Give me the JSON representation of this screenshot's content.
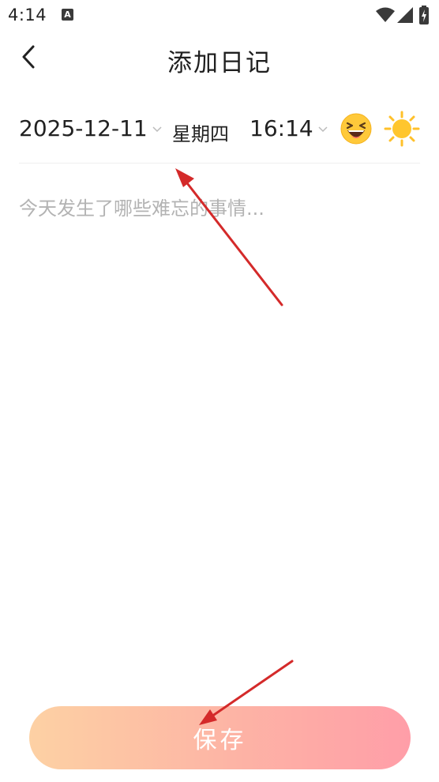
{
  "status_bar": {
    "time": "4:14",
    "notification_letter": "A"
  },
  "header": {
    "title": "添加日记"
  },
  "meta": {
    "date": "2025-12-11",
    "weekday": "星期四",
    "time": "16:14",
    "mood_icon": "laughing-face-icon",
    "weather_icon": "sun-icon"
  },
  "content": {
    "placeholder": "今天发生了哪些难忘的事情...",
    "value": ""
  },
  "footer": {
    "save_label": "保存"
  },
  "colors": {
    "save_gradient_start": "#fdd1a4",
    "save_gradient_end": "#ff9ea8",
    "placeholder": "#b3b3b3",
    "annotation_arrow": "#d42a2a"
  }
}
